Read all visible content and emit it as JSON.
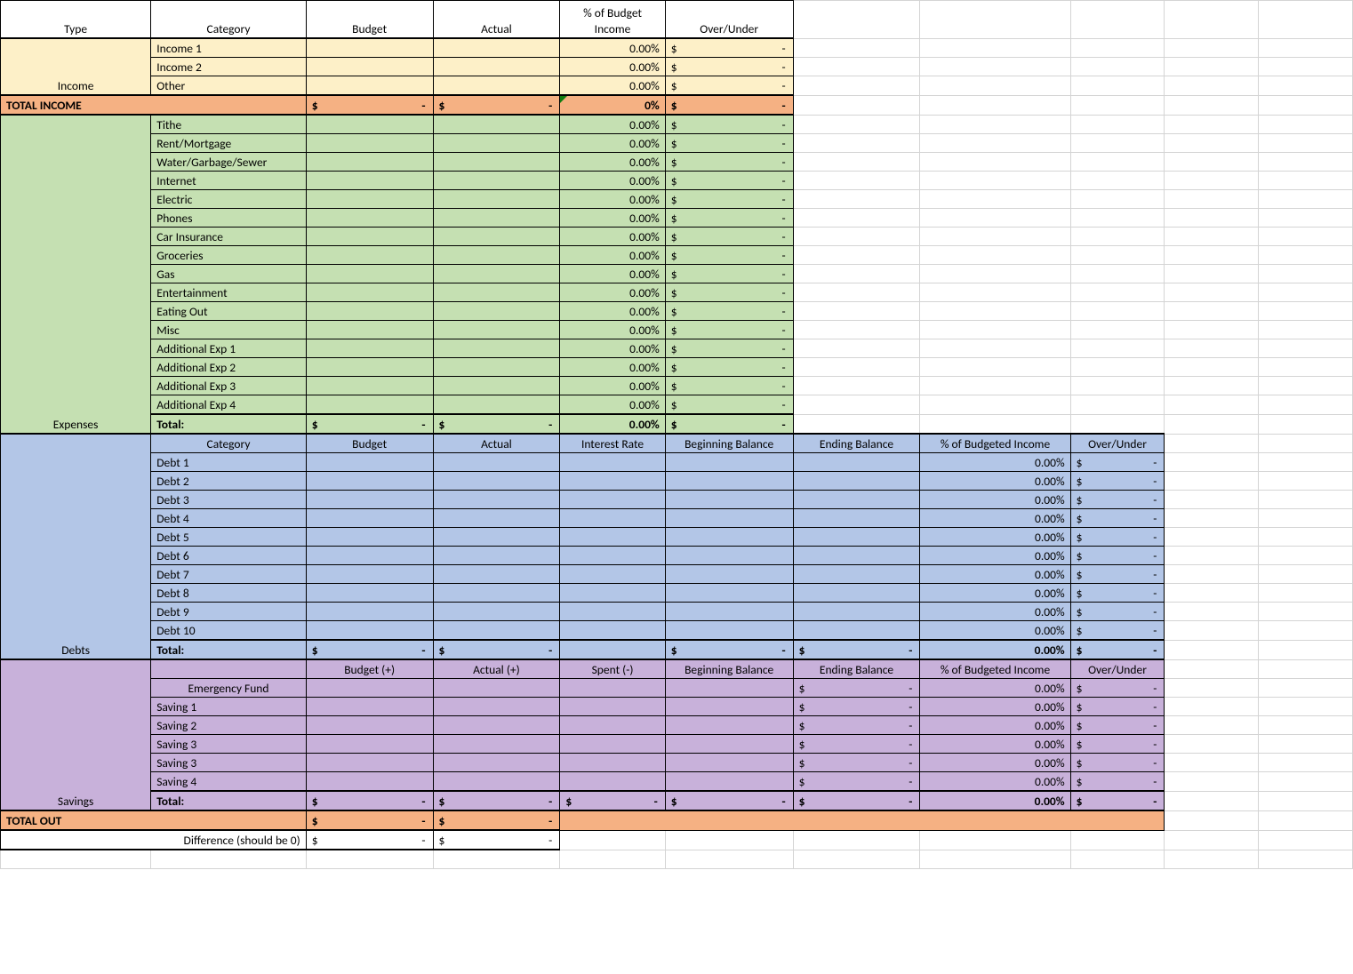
{
  "headers": {
    "type": "Type",
    "category": "Category",
    "budget": "Budget",
    "actual": "Actual",
    "pct_income": "% of Budget Income",
    "over_under": "Over/Under",
    "interest": "Interest Rate",
    "begin": "Beginning Balance",
    "end": "Ending Balance",
    "pct_budgeted": "% of Budgeted Income",
    "budget_p": "Budget  (+)",
    "actual_p": "Actual (+)",
    "spent_m": "Spent (-)"
  },
  "labels": {
    "income": "Income",
    "expenses": "Expenses",
    "debts": "Debts",
    "savings": "Savings",
    "total_income": "TOTAL INCOME",
    "total": "Total:",
    "total_out": "TOTAL OUT",
    "diff": "Difference (should be 0)"
  },
  "zero_pct": "0.00%",
  "zero_pct_int": "0%",
  "dollar": "$",
  "dash": "-",
  "income_rows": [
    "Income 1",
    "Income 2",
    "Other"
  ],
  "expense_rows": [
    "Tithe",
    "Rent/Mortgage",
    "Water/Garbage/Sewer",
    "Internet",
    "Electric",
    "Phones",
    "Car Insurance",
    "Groceries",
    "Gas",
    "Entertainment",
    "Eating Out",
    "Misc",
    "Additional Exp 1",
    "Additional Exp 2",
    "Additional Exp 3",
    "Additional Exp 4"
  ],
  "debt_rows": [
    "Debt 1",
    "Debt 2",
    "Debt 3",
    "Debt 4",
    "Debt 5",
    "Debt 6",
    "Debt 7",
    "Debt 8",
    "Debt 9",
    "Debt 10"
  ],
  "savings_rows": [
    "Emergency Fund",
    "Saving 1",
    "Saving 2",
    "Saving 3",
    "Saving 3",
    "Saving 4"
  ]
}
